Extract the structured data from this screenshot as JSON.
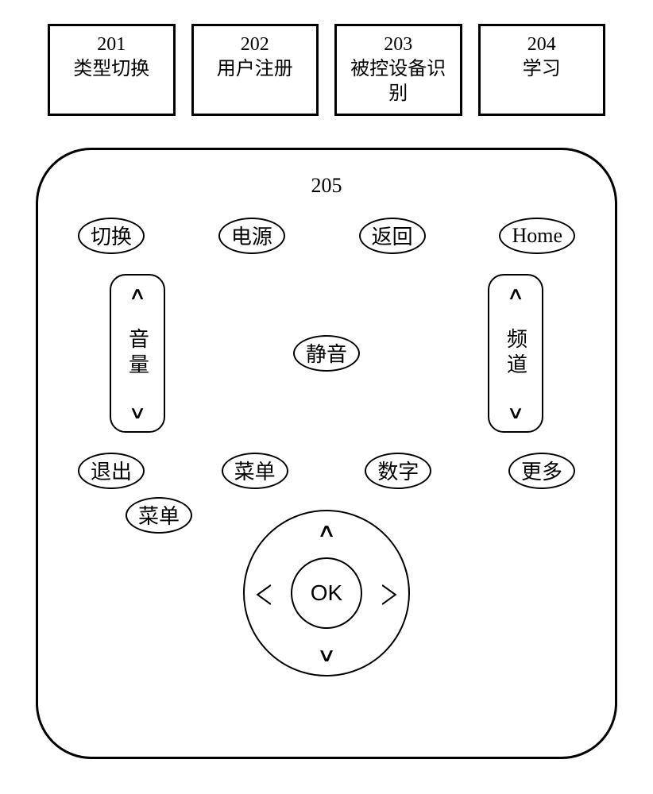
{
  "top": [
    {
      "num": "201",
      "label": "类型切换"
    },
    {
      "num": "202",
      "label": "用户注册"
    },
    {
      "num": "203",
      "label": "被控设备识别"
    },
    {
      "num": "204",
      "label": "学习"
    }
  ],
  "panel_num": "205",
  "row1": {
    "b1": "切换",
    "b2": "电源",
    "b3": "返回",
    "b4": "Home"
  },
  "rocker_left": {
    "up": "∧",
    "label": "音量",
    "down": "∨"
  },
  "rocker_right": {
    "up": "∧",
    "label": "频道",
    "down": "∨"
  },
  "mute": "静音",
  "row3": {
    "b1": "退出",
    "b2": "菜单",
    "b3": "数字",
    "b4": "更多"
  },
  "row4": {
    "b1": "菜单"
  },
  "dpad": {
    "ok": "OK",
    "up": "∧",
    "down": "∨",
    "left": "＜",
    "right": "＞"
  }
}
